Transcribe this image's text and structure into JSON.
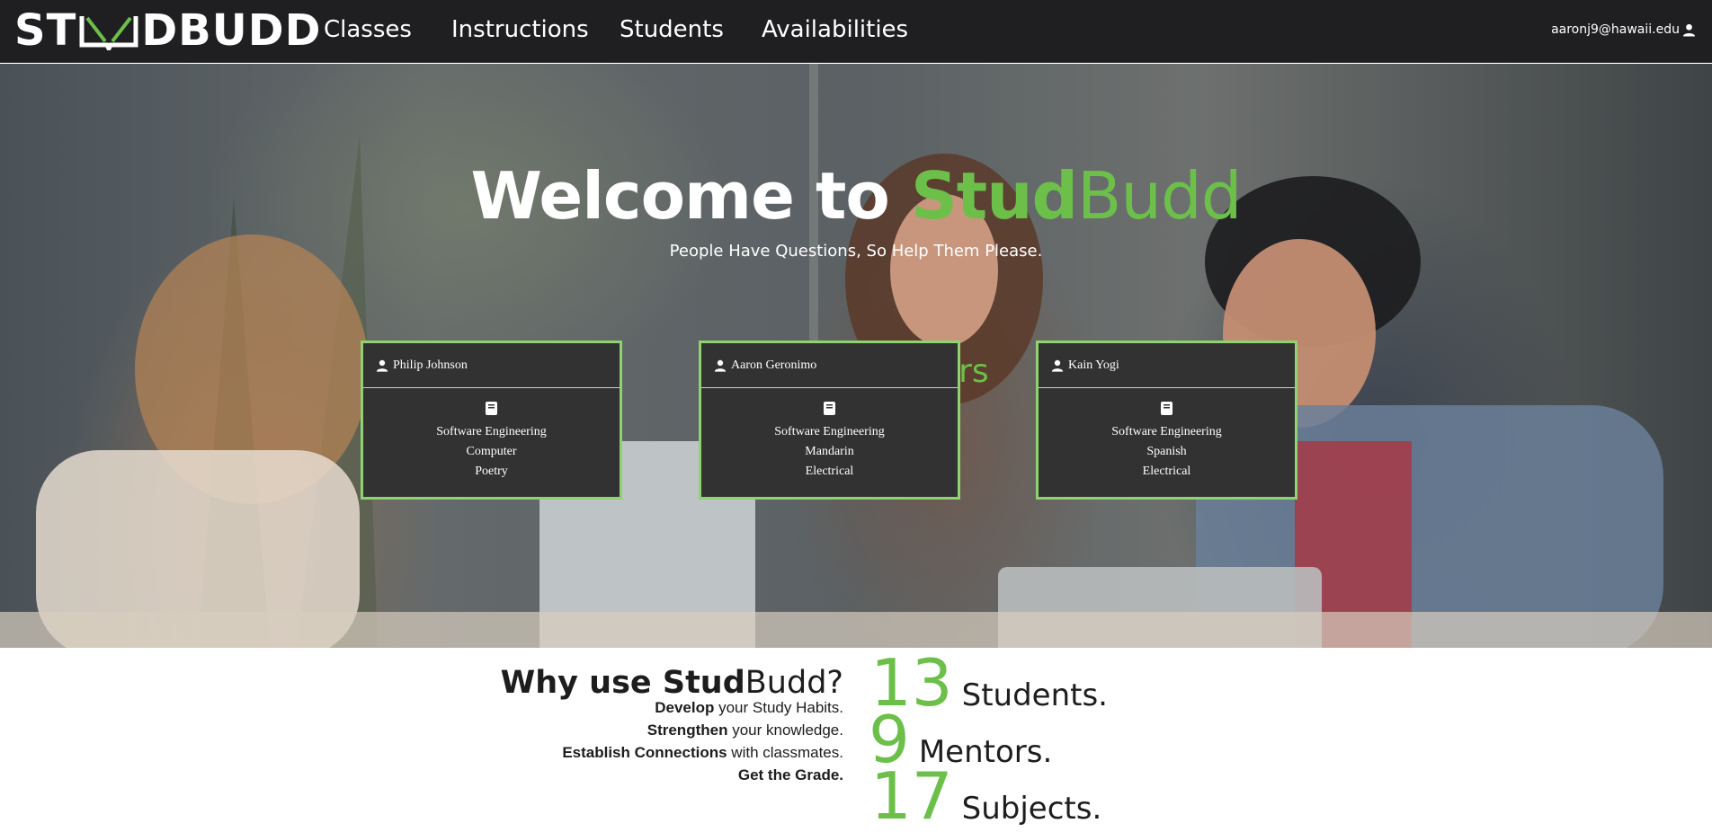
{
  "brand": {
    "logo_left": "ST",
    "logo_right": "DBUDD",
    "green": "#6cc04a",
    "dark": "#1f1f21"
  },
  "nav": {
    "items": [
      {
        "label": "Classes"
      },
      {
        "label": "Instructions"
      },
      {
        "label": "Students"
      },
      {
        "label": "Availabilities"
      }
    ],
    "user_email": "aaronj9@hawaii.edu",
    "user_icon": "user-icon"
  },
  "hero": {
    "title_prefix": "Welcome to ",
    "title_brand_bold": "Stud",
    "title_brand_light": "Budd",
    "subtitle": "People Have Questions, So Help Them Please.",
    "mentors_heading": "Our Top Mentors"
  },
  "mentors": [
    {
      "name": "Philip Johnson",
      "subjects": [
        "Software Engineering",
        "Computer",
        "Poetry"
      ]
    },
    {
      "name": "Aaron Geronimo",
      "subjects": [
        "Software Engineering",
        "Mandarin",
        "Electrical"
      ]
    },
    {
      "name": "Kain Yogi",
      "subjects": [
        "Software Engineering",
        "Spanish",
        "Electrical"
      ]
    }
  ],
  "why": {
    "title_prefix": "Why use ",
    "title_bold": "Stud",
    "title_light": "Budd?",
    "lines": [
      {
        "bold": "Develop",
        "rest": " your Study Habits."
      },
      {
        "bold": "Strengthen",
        "rest": " your knowledge."
      },
      {
        "bold": "Establish Connections",
        "rest": " with classmates."
      },
      {
        "bold": "Get the Grade.",
        "rest": ""
      }
    ]
  },
  "stats": [
    {
      "number": "13",
      "label": "Students."
    },
    {
      "number": "9",
      "label": "Mentors."
    },
    {
      "number": "17",
      "label": "Subjects."
    }
  ]
}
